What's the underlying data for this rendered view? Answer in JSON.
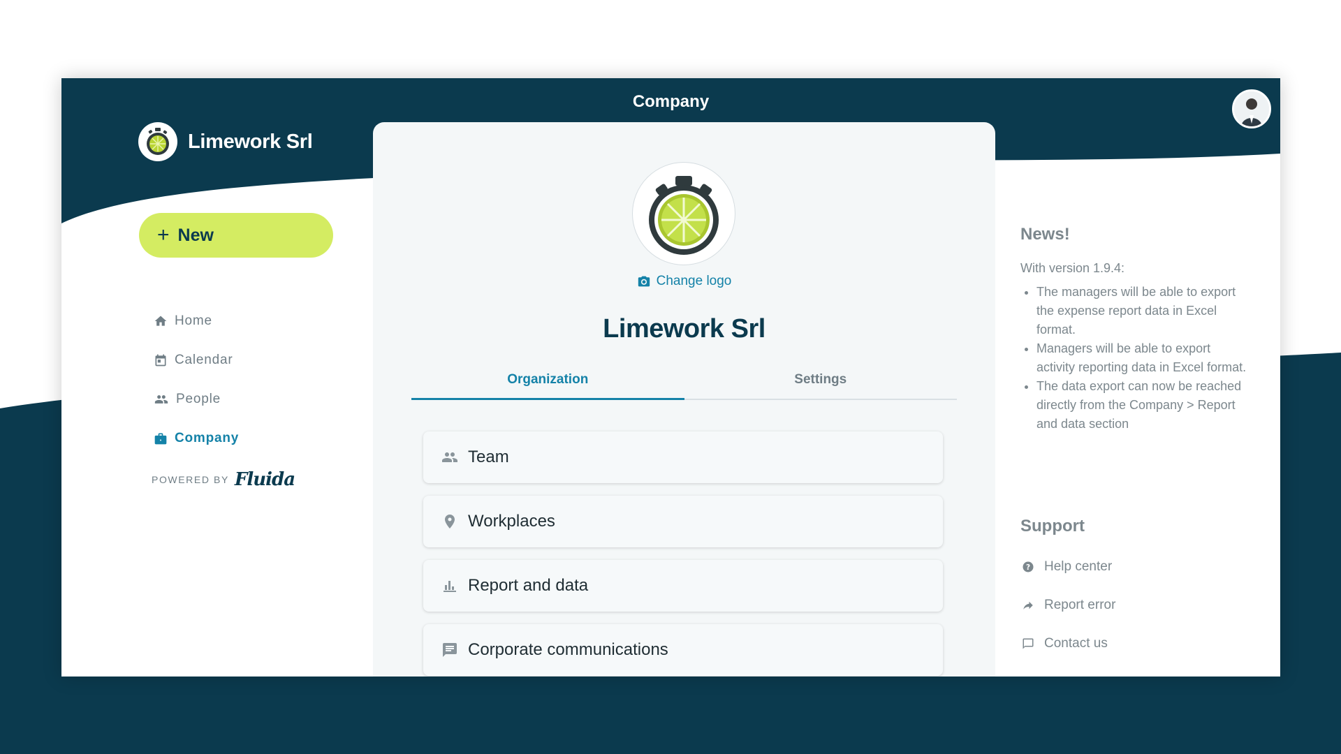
{
  "header": {
    "title": "Company"
  },
  "brand": {
    "name": "Limework Srl"
  },
  "sidebar": {
    "new_label": "New",
    "items": [
      {
        "label": "Home",
        "icon": "home-icon"
      },
      {
        "label": "Calendar",
        "icon": "calendar-icon"
      },
      {
        "label": "People",
        "icon": "people-icon"
      },
      {
        "label": "Company",
        "icon": "briefcase-icon",
        "active": true
      }
    ],
    "powered_by": "POWERED BY",
    "powered_brand": "Fluida"
  },
  "company": {
    "change_logo": "Change logo",
    "name": "Limework Srl",
    "tabs": [
      {
        "label": "Organization",
        "active": true
      },
      {
        "label": "Settings"
      }
    ],
    "sections": [
      {
        "label": "Team",
        "icon": "people-icon"
      },
      {
        "label": "Workplaces",
        "icon": "location-pin-icon"
      },
      {
        "label": "Report and data",
        "icon": "bar-chart-icon"
      },
      {
        "label": "Corporate communications",
        "icon": "message-icon"
      }
    ]
  },
  "news": {
    "title": "News!",
    "intro": "With version 1.9.4:",
    "items": [
      "The managers will be able to export the expense report data in Excel format.",
      "Managers will be able to export activity reporting data in Excel format.",
      "The data export can now be reached directly from the Company > Report and data section"
    ]
  },
  "support": {
    "title": "Support",
    "items": [
      {
        "label": "Help center",
        "icon": "help-icon"
      },
      {
        "label": "Report error",
        "icon": "share-arrow-icon"
      },
      {
        "label": "Contact us",
        "icon": "chat-icon"
      }
    ]
  },
  "colors": {
    "primary_dark": "#0b3a4e",
    "accent_lime": "#d4ec62",
    "link_blue": "#1482a8",
    "muted_text": "#7c878d"
  }
}
